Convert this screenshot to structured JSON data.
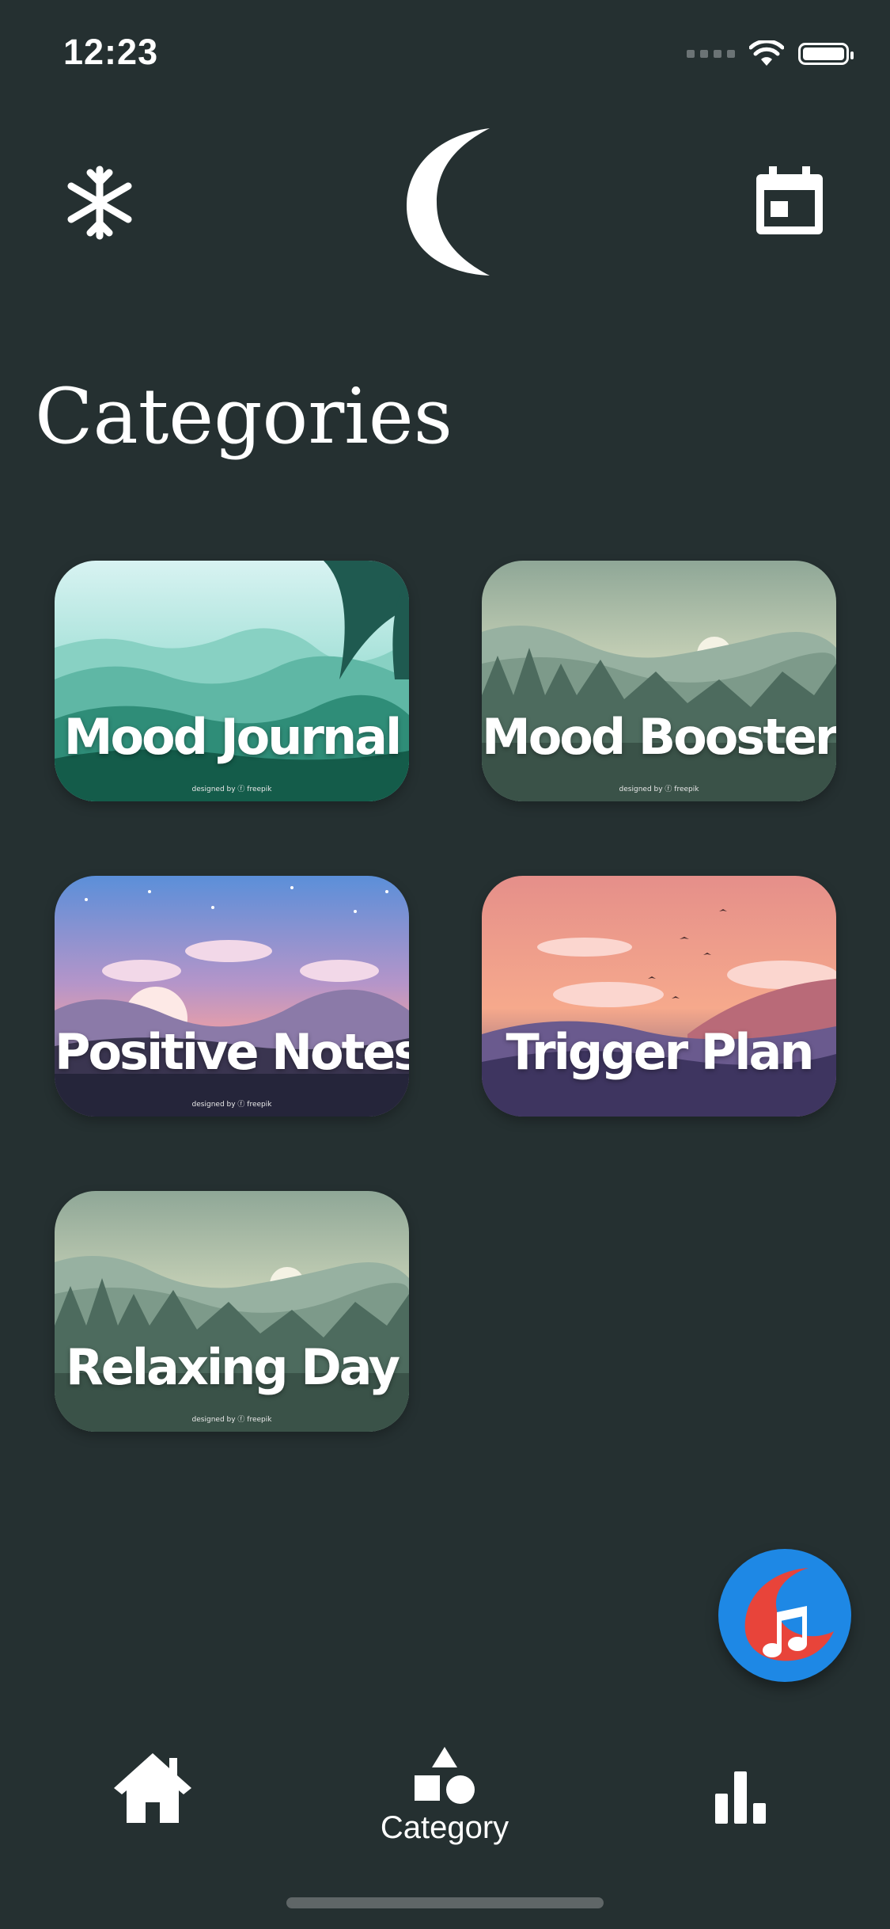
{
  "status_bar": {
    "time": "12:23"
  },
  "header": {
    "left_icon": "snowflake-icon",
    "center_icon": "crescent-moon-icon",
    "right_icon": "calendar-icon"
  },
  "page_title": "Categories",
  "categories": [
    {
      "label": "Mood Journal",
      "credit": "designed by ⓕ freepik"
    },
    {
      "label": "Mood Booster",
      "credit": "designed by ⓕ freepik"
    },
    {
      "label": "Positive Notes",
      "credit": "designed by ⓕ freepik"
    },
    {
      "label": "Trigger Plan",
      "credit": ""
    },
    {
      "label": "Relaxing Day",
      "credit": "designed by ⓕ freepik"
    }
  ],
  "fab": {
    "icon": "moon-music-icon"
  },
  "bottom_nav": [
    {
      "icon": "home-icon",
      "label": ""
    },
    {
      "icon": "category-shapes-icon",
      "label": "Category"
    },
    {
      "icon": "bar-chart-icon",
      "label": ""
    }
  ],
  "colors": {
    "background": "#253031",
    "fab": "#1e88e5",
    "fab_moon": "#e8443a",
    "text": "#ffffff"
  }
}
